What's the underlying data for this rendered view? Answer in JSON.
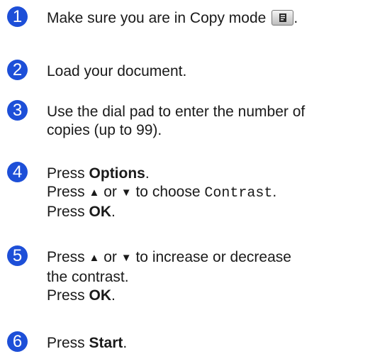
{
  "steps": [
    {
      "num": "1",
      "text": "Make sure you are in Copy mode",
      "icon": "copy-mode-icon",
      "tail": "."
    },
    {
      "num": "2",
      "text": "Load your document."
    },
    {
      "num": "3",
      "line1": "Use the dial pad to enter the number of",
      "line2": "copies (up to 99)."
    },
    {
      "num": "4",
      "press": "Press",
      "options": "Options",
      "period": ".",
      "line2_pre": "Press",
      "up": "▲",
      "or": "or",
      "down": "▼",
      "to_choose": "to choose",
      "mono": "Contrast",
      "line2_end": ".",
      "line3_pre": "Press",
      "ok": "OK",
      "line3_end": "."
    },
    {
      "num": "5",
      "line1_pre": "Press",
      "up": "▲",
      "or": "or",
      "down": "▼",
      "line1_post": "to increase or decrease",
      "line2": "the contrast.",
      "line3_pre": "Press",
      "ok": "OK",
      "line3_end": "."
    },
    {
      "num": "6",
      "press": "Press",
      "start": "Start",
      "end": "."
    }
  ],
  "colors": {
    "badge": "#1d4fd8"
  }
}
